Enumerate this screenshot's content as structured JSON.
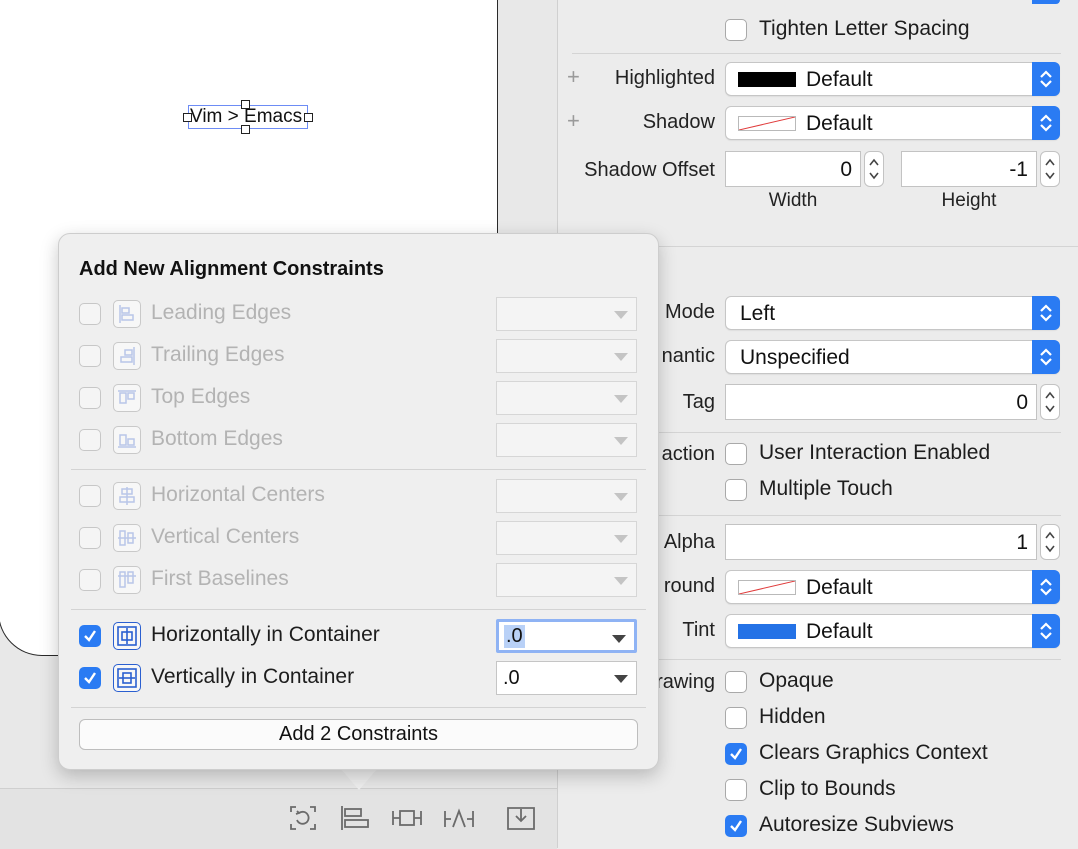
{
  "canvas": {
    "label_text": "Vim > Emacs",
    "bottom_toolbar": {
      "icons": [
        "update-frames-icon",
        "align-icon",
        "add-new-constraints-icon",
        "resolve-auto-layout-icon",
        "embed-in-icon"
      ]
    }
  },
  "inspector": {
    "tighten_letter_spacing": {
      "label": "Tighten Letter Spacing",
      "checked": false
    },
    "highlighted": {
      "label": "Highlighted",
      "value": "Default",
      "swatch": "#000000"
    },
    "shadow": {
      "label": "Shadow",
      "value": "Default",
      "swatch": "none"
    },
    "shadow_offset": {
      "label": "Shadow Offset",
      "width": {
        "value": "0",
        "caption": "Width"
      },
      "height": {
        "value": "-1",
        "caption": "Height"
      }
    },
    "content_mode": {
      "label": "Mode",
      "value": "Left"
    },
    "semantic": {
      "label": "nantic",
      "value": "Unspecified"
    },
    "tag": {
      "label": "Tag",
      "value": "0"
    },
    "interaction": {
      "label": "action",
      "user_interaction_enabled": {
        "label": "User Interaction Enabled",
        "checked": false
      },
      "multiple_touch": {
        "label": "Multiple Touch",
        "checked": false
      }
    },
    "alpha": {
      "label": "Alpha",
      "value": "1"
    },
    "background": {
      "label": "round",
      "value": "Default",
      "swatch": "none"
    },
    "tint": {
      "label": "Tint",
      "value": "Default",
      "swatch": "#2472e6"
    },
    "drawing": {
      "label": "rawing",
      "opaque": {
        "label": "Opaque",
        "checked": false
      },
      "hidden": {
        "label": "Hidden",
        "checked": false
      },
      "clears_graphics_context": {
        "label": "Clears Graphics Context",
        "checked": true
      },
      "clip_to_bounds": {
        "label": "Clip to Bounds",
        "checked": false
      },
      "autoresize_subviews": {
        "label": "Autoresize Subviews",
        "checked": true
      }
    }
  },
  "popover": {
    "title": "Add New Alignment Constraints",
    "rows": [
      {
        "label": "Leading Edges",
        "checked": false,
        "enabled": false,
        "value": ""
      },
      {
        "label": "Trailing Edges",
        "checked": false,
        "enabled": false,
        "value": ""
      },
      {
        "label": "Top Edges",
        "checked": false,
        "enabled": false,
        "value": ""
      },
      {
        "label": "Bottom Edges",
        "checked": false,
        "enabled": false,
        "value": ""
      },
      {
        "label": "Horizontal Centers",
        "checked": false,
        "enabled": false,
        "value": ""
      },
      {
        "label": "Vertical Centers",
        "checked": false,
        "enabled": false,
        "value": ""
      },
      {
        "label": "First Baselines",
        "checked": false,
        "enabled": false,
        "value": ""
      },
      {
        "label": "Horizontally in Container",
        "checked": true,
        "enabled": true,
        "value": ".0"
      },
      {
        "label": "Vertically in Container",
        "checked": true,
        "enabled": true,
        "value": ".0"
      }
    ],
    "add_button_label": "Add 2 Constraints"
  },
  "colors": {
    "accent": "#2a7bf3",
    "selection_outline": "#6d8cf5"
  }
}
